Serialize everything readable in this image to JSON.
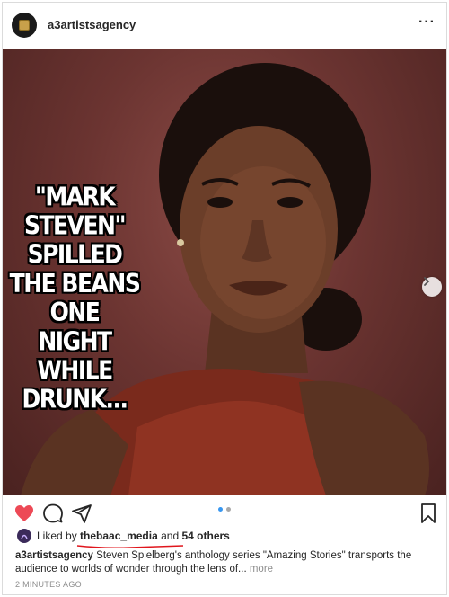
{
  "post": {
    "username": "a3artistsagency",
    "more_label": "···",
    "overlay_lines": [
      "\"MARK",
      "STEVEN\"",
      "SPILLED",
      "THE BEANS",
      "ONE",
      "NIGHT WHILE",
      "DRUNK..."
    ],
    "carousel": {
      "count": 2,
      "active_index": 0
    }
  },
  "likes": {
    "prefix": "Liked by",
    "user": "thebaac_media",
    "middle": "and",
    "others": "54 others"
  },
  "caption": {
    "username": "a3artistsagency",
    "text": "Steven Spielberg's anthology series \"Amazing Stories\" transports the audience to worlds of wonder through the lens of...",
    "more_label": "more"
  },
  "timestamp": "2 MINUTES AGO",
  "colors": {
    "like_heart": "#ed4956",
    "carousel_active": "#3897f0",
    "annotation_underline": "#e0161d"
  },
  "icons": [
    "heart-icon",
    "comment-icon",
    "share-icon",
    "bookmark-icon",
    "chevron-right-icon",
    "more-icon"
  ]
}
